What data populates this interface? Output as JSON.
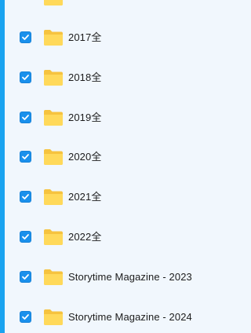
{
  "colors": {
    "background": "#f1f7fd",
    "accent_bar": "#1aa3f0",
    "checkbox": "#1a90ec",
    "folder_back": "#f6c33f",
    "folder_front": "#ffd95a",
    "text": "#1c1c1c"
  },
  "file_list": {
    "items": [
      {
        "name": "2017全",
        "checked": true,
        "icon": "folder-icon"
      },
      {
        "name": "2018全",
        "checked": true,
        "icon": "folder-icon"
      },
      {
        "name": "2019全",
        "checked": true,
        "icon": "folder-icon"
      },
      {
        "name": "2020全",
        "checked": true,
        "icon": "folder-icon"
      },
      {
        "name": "2021全",
        "checked": true,
        "icon": "folder-icon"
      },
      {
        "name": "2022全",
        "checked": true,
        "icon": "folder-icon"
      },
      {
        "name": "Storytime Magazine - 2023",
        "checked": true,
        "icon": "folder-icon"
      },
      {
        "name": "Storytime Magazine - 2024",
        "checked": true,
        "icon": "folder-icon"
      }
    ]
  }
}
